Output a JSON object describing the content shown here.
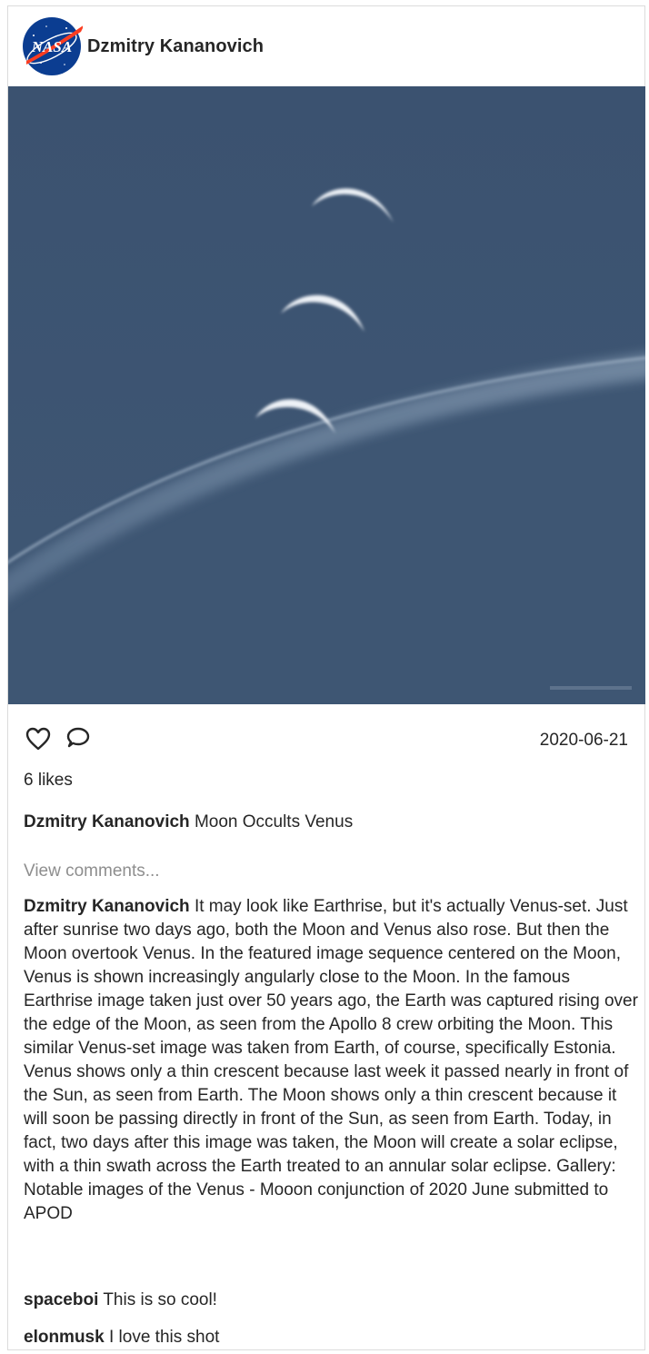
{
  "post": {
    "username": "Dzmitry Kananovich",
    "avatar_logo_text": "NASA",
    "date": "2020-06-21",
    "likes": "6 likes",
    "title": "Moon Occults Venus",
    "view_comments": "View comments...",
    "description": "It may look like Earthrise, but it's actually Venus-set. Just after sunrise two days ago, both the Moon and Venus also rose. But then the Moon overtook Venus. In the featured image sequence centered on the Moon, Venus is shown increasingly angularly close to the Moon. In the famous Earthrise image taken just over 50 years ago, the Earth was captured rising over the edge of the Moon, as seen from the Apollo 8 crew orbiting the Moon. This similar Venus-set image was taken from Earth, of course, specifically Estonia. Venus shows only a thin crescent because last week it passed nearly in front of the Sun, as seen from Earth. The Moon shows only a thin crescent because it will soon be passing directly in front of the Sun, as seen from Earth. Today, in fact, two days after this image was taken, the Moon will create a solar eclipse, with a thin swath across the Earth treated to an annular solar eclipse. Gallery: Notable images of the Venus - Mooon conjunction of 2020 June submitted to APOD"
  },
  "comments": [
    {
      "user": "spaceboi",
      "text": "This is so cool!"
    },
    {
      "user": "elonmusk",
      "text": "I love this shot"
    }
  ],
  "icons": {
    "like": "heart-icon",
    "comment": "speech-bubble-icon"
  },
  "colors": {
    "photo_sky": "#3c5470",
    "muted_text": "#8e8e8e",
    "nasa_blue": "#0b3d91",
    "nasa_red": "#fc3d21"
  }
}
